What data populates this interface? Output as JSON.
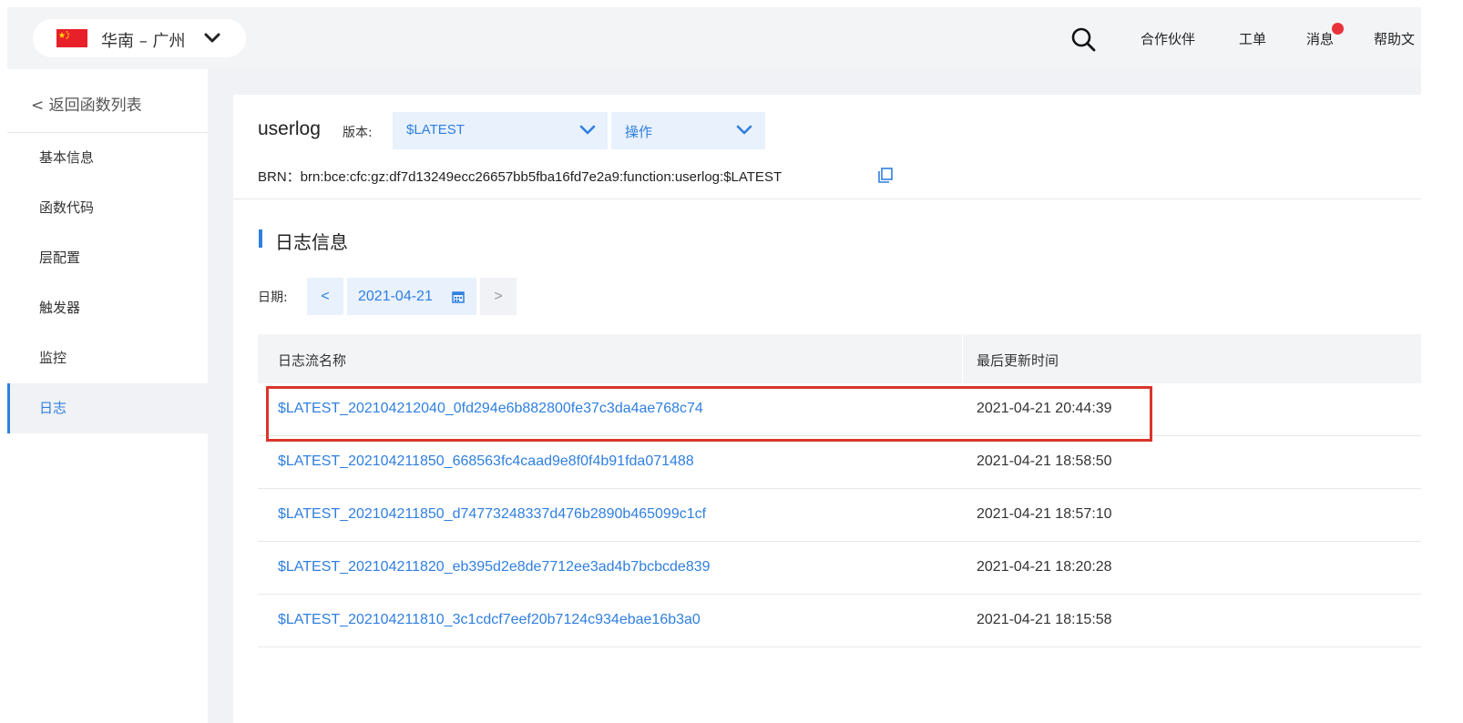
{
  "topbar": {
    "region": "华南 – 广州",
    "region_chevron_icon": "chevron-down-icon",
    "search_icon": "search-icon",
    "links": [
      "合作伙伴",
      "工单",
      "消息",
      "帮助文"
    ],
    "message_badge_color": "#e8333a"
  },
  "sidebar": {
    "back": "< 返回函数列表",
    "items": [
      "基本信息",
      "函数代码",
      "层配置",
      "触发器",
      "监控",
      "日志"
    ],
    "active_index": 5
  },
  "header": {
    "function_name": "userlog",
    "version_label": "版本:",
    "version_value": "$LATEST",
    "action_value": "操作",
    "brn": "BRN：brn:bce:cfc:gz:df7d13249ecc26657bb5fba16fd7e2a9:function:userlog:$LATEST",
    "copy_icon": "copy-icon"
  },
  "logs": {
    "section_title": "日志信息",
    "date_label": "日期:",
    "date_prev": "<",
    "date_value": "2021-04-21",
    "date_next": ">",
    "columns": [
      "日志流名称",
      "最后更新时间"
    ],
    "rows": [
      {
        "name": "$LATEST_202104212040_0fd294e6b882800fe37c3da4ae768c74",
        "time": "2021-04-21 20:44:39"
      },
      {
        "name": "$LATEST_202104211850_668563fc4caad9e8f0f4b91fda071488",
        "time": "2021-04-21 18:58:50"
      },
      {
        "name": "$LATEST_202104211850_d74773248337d476b2890b465099c1cf",
        "time": "2021-04-21 18:57:10"
      },
      {
        "name": "$LATEST_202104211820_eb395d2e8de7712ee3ad4b7bcbcde839",
        "time": "2021-04-21 18:20:28"
      },
      {
        "name": "$LATEST_202104211810_3c1cdcf7eef20b7124c934ebae16b3a0",
        "time": "2021-04-21 18:15:58"
      }
    ]
  },
  "colors": {
    "accent": "#2f7fe0",
    "highlight_border": "#d9352c",
    "select_bg": "#e8f1fc"
  }
}
